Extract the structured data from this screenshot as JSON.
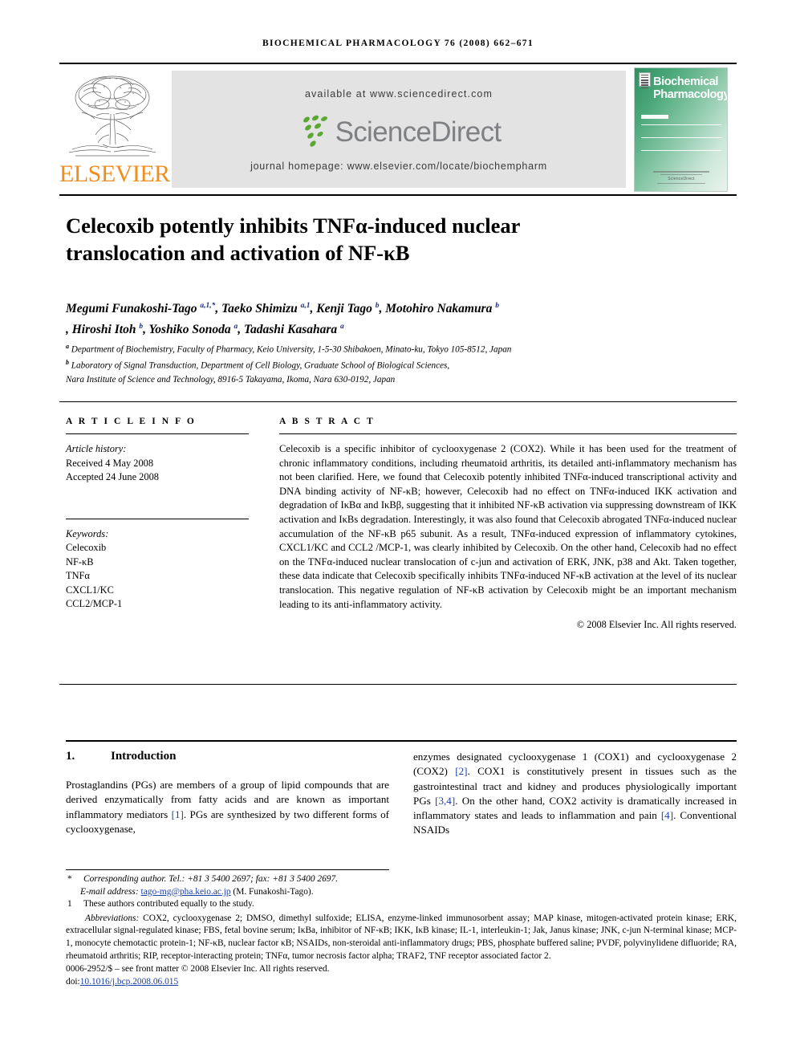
{
  "running_head": "BIOCHEMICAL PHARMACOLOGY 76 (2008) 662–671",
  "masthead": {
    "publisher": "ELSEVIER",
    "available_at": "available at www.sciencedirect.com",
    "sciencedirect_wordmark": "ScienceDirect",
    "journal_homepage": "journal homepage: www.elsevier.com/locate/biochempharm",
    "cover_title_line1": "Biochemical",
    "cover_title_line2": "Pharmacology",
    "cover_footer": "ScienceDirect",
    "brand_orange": "#F08D1C",
    "cover_green": "#2f8f63",
    "sciencedirect_gray": "#7e8083",
    "banner_gray": "#e3e3e3"
  },
  "article": {
    "title_line1": "Celecoxib potently inhibits TNFα-induced nuclear",
    "title_line2": "translocation and activation of NF-κB",
    "authors_html": "Megumi Funakoshi-Tago <sup>a,1,*</sup>, Taeko Shimizu <sup>a,1</sup>, Kenji Tago <sup>b</sup>, Motohiro Nakamura <sup>b</sup><br>, Hiroshi Itoh <sup>b</sup>, Yoshiko Sonoda <sup>a</sup>, Tadashi Kasahara <sup>a</sup>",
    "affiliation_a": "Department of Biochemistry, Faculty of Pharmacy, Keio University, 1-5-30 Shibakoen, Minato-ku, Tokyo 105-8512, Japan",
    "affiliation_b_line1": "Laboratory of Signal Transduction, Department of Cell Biology, Graduate School of Biological Sciences,",
    "affiliation_b_line2": "Nara Institute of Science and Technology, 8916-5 Takayama, Ikoma, Nara 630-0192, Japan"
  },
  "article_info": {
    "heading": "A R T I C L E   I N F O",
    "history_label": "Article history:",
    "received": "Received 4 May 2008",
    "accepted": "Accepted 24 June 2008",
    "keywords_label": "Keywords:",
    "keywords": [
      "Celecoxib",
      "NF-κB",
      "TNFα",
      "CXCL1/KC",
      "CCL2/MCP-1"
    ]
  },
  "abstract": {
    "heading": "A B S T R A C T",
    "text": "Celecoxib is a specific inhibitor of cyclooxygenase 2 (COX2). While it has been used for the treatment of chronic inflammatory conditions, including rheumatoid arthritis, its detailed anti-inflammatory mechanism has not been clarified. Here, we found that Celecoxib potently inhibited TNFα-induced transcriptional activity and DNA binding activity of NF-κB; however, Celecoxib had no effect on TNFα-induced IKK activation and degradation of IκBα and IκBβ, suggesting that it inhibited NF-κB activation via suppressing downstream of IKK activation and IκBs degradation. Interestingly, it was also found that Celecoxib abrogated TNFα-induced nuclear accumulation of the NF-κB p65 subunit. As a result, TNFα-induced expression of inflammatory cytokines, CXCL1/KC and CCL2 /MCP-1, was clearly inhibited by Celecoxib. On the other hand, Celecoxib had no effect on the TNFα-induced nuclear translocation of c-jun and activation of ERK, JNK, p38 and Akt. Taken together, these data indicate that Celecoxib specifically inhibits TNFα-induced NF-κB activation at the level of its nuclear translocation. This negative regulation of NF-κB activation by Celecoxib might be an important mechanism leading to its anti-inflammatory activity.",
    "copyright": "© 2008 Elsevier Inc. All rights reserved."
  },
  "body": {
    "section_number": "1.",
    "section_title": "Introduction",
    "left_column_html": "Prostaglandins (PGs) are members of a group of lipid compounds that are derived enzymatically from fatty acids and are known as important inflammatory mediators <span class=\"cite\">[1]</span>. PGs are synthesized by two different forms of cyclooxygenase,",
    "right_column_html": "enzymes designated cyclooxygenase 1 (COX1) and cyclooxygenase 2 (COX2) <span class=\"cite\">[2]</span>. COX1 is constitutively present in tissues such as the gastrointestinal tract and kidney and produces physiologically important PGs <span class=\"cite\">[3,4]</span>. On the other hand, COX2 activity is dramatically increased in inflammatory states and leads to inflammation and pain <span class=\"cite\">[4]</span>. Conventional NSAIDs"
  },
  "footnotes": {
    "corresponding_marker": "*",
    "corresponding_text": "Corresponding author. Tel.: +81 3 5400 2697; fax: +81 3 5400 2697.",
    "email_label": "E-mail address:",
    "email": "tago-mg@pha.keio.ac.jp",
    "email_owner": "(M. Funakoshi-Tago).",
    "equal_marker": "1",
    "equal_text": "These authors contributed equally to the study.",
    "abbrev_label": "Abbreviations:",
    "abbrev_text": "COX2, cyclooxygenase 2; DMSO, dimethyl sulfoxide; ELISA, enzyme-linked immunosorbent assay; MAP kinase, mitogen-activated protein kinase; ERK, extracellular signal-regulated kinase; FBS, fetal bovine serum; IκBa, inhibitor of NF-κB; IKK, IκB kinase; IL-1, interleukin-1; Jak, Janus kinase; JNK, c-jun N-terminal kinase; MCP-1, monocyte chemotactic protein-1; NF-κB, nuclear factor κB; NSAIDs, non-steroidal anti-inflammatory drugs; PBS, phosphate buffered saline; PVDF, polyvinylidene difluoride; RA, rheumatoid arthritis; RIP, receptor-interacting protein; TNFα, tumor necrosis factor alpha; TRAF2, TNF receptor associated factor 2.",
    "issn_line": "0006-2952/$ – see front matter © 2008 Elsevier Inc. All rights reserved.",
    "doi_prefix": "doi:",
    "doi": "10.1016/j.bcp.2008.06.015"
  }
}
